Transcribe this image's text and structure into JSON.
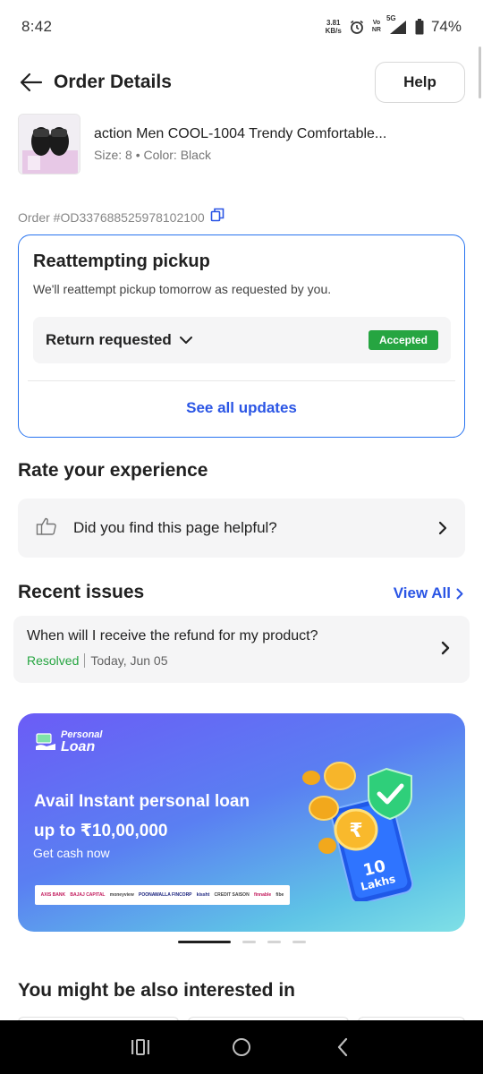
{
  "status_bar": {
    "time": "8:42",
    "net_speed_value": "3.81",
    "net_speed_unit": "KB/s",
    "volte_top": "Vo",
    "volte_bottom": "NR",
    "network": "5G",
    "battery": "74%"
  },
  "header": {
    "title": "Order Details",
    "help_label": "Help"
  },
  "product": {
    "name": "action Men COOL-1004 Trendy Comfortable...",
    "meta": "Size: 8 • Color: Black"
  },
  "order_id": "Order #OD337688525978102100",
  "status_card": {
    "title": "Reattempting pickup",
    "subtitle": "We'll reattempt pickup tomorrow as requested by you.",
    "return_label": "Return requested",
    "badge": "Accepted",
    "see_all": "See all updates"
  },
  "rate": {
    "title": "Rate your experience",
    "question": "Did you find this page helpful?"
  },
  "issues": {
    "title": "Recent issues",
    "view_all": "View All",
    "items": [
      {
        "question": "When will I receive the refund for my product?",
        "status": "Resolved",
        "date": "Today, Jun 05"
      }
    ]
  },
  "banner": {
    "logo_line1": "Personal",
    "logo_line2": "Loan",
    "headline_line1": "Avail Instant personal loan",
    "headline_line2": "up to ₹10,00,000",
    "cta": "Get cash now",
    "art_text_1": "10",
    "art_text_2": "Lakhs",
    "partners": [
      "AXIS BANK",
      "BAJAJ CAPITAL",
      "moneyview",
      "POONAWALLA FINCORP",
      "kissht",
      "CREDIT SAISON",
      "finnable",
      "fibe"
    ]
  },
  "carousel": {
    "active_index": 0,
    "count": 4
  },
  "interested": {
    "title": "You might be also interested in"
  },
  "colors": {
    "accent_blue": "#2a55e5",
    "card_border": "#2874f0",
    "success_green": "#26a541"
  }
}
